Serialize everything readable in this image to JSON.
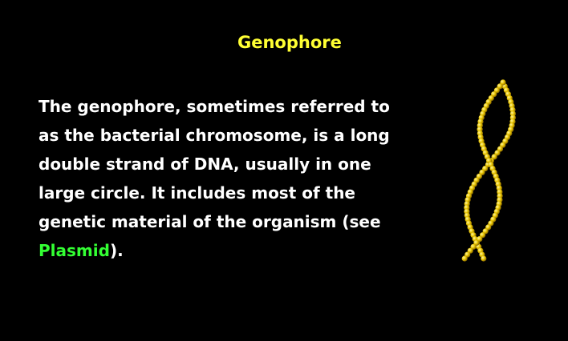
{
  "slide": {
    "title": "Genophore",
    "body_lines": [
      "The genophore, sometimes referred to",
      "as the bacterial chromosome, is a long",
      "double strand of DNA, usually in one",
      "large circle. It includes most of the",
      "genetic material of the organism (see"
    ],
    "link_text": "Plasmid",
    "after_link": ")."
  },
  "colors": {
    "background": "#000000",
    "title": "#FFFF33",
    "body": "#FFFFFF",
    "link": "#33FF33",
    "dna_bead": "#E8C400"
  },
  "image": {
    "icon": "dna-helix-icon"
  }
}
